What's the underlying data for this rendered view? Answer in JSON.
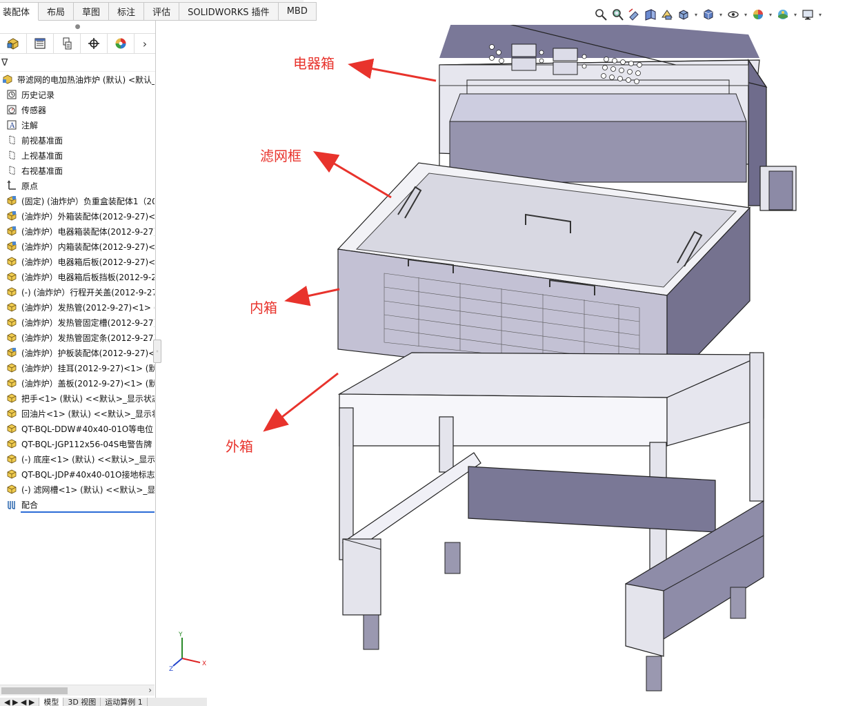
{
  "command_tabs": [
    "装配体",
    "布局",
    "草图",
    "标注",
    "评估",
    "SOLIDWORKS 插件",
    "MBD"
  ],
  "panel_tabs": [
    {
      "icon": "feature-manager-icon"
    },
    {
      "icon": "property-manager-icon"
    },
    {
      "icon": "configuration-manager-icon"
    },
    {
      "icon": "dimxpert-icon"
    },
    {
      "icon": "display-manager-icon"
    }
  ],
  "panel_more_glyph": "›",
  "filter_glyph": "∇",
  "tree": [
    {
      "label": "带滤网的电加热油炸炉 (默认) <默认_显示",
      "icon": "assembly-root-icon"
    },
    {
      "label": "历史记录",
      "icon": "history-icon"
    },
    {
      "label": "传感器",
      "icon": "sensor-icon"
    },
    {
      "label": "注解",
      "icon": "annotation-icon"
    },
    {
      "label": "前视基准面",
      "icon": "plane-icon"
    },
    {
      "label": "上视基准面",
      "icon": "plane-icon"
    },
    {
      "label": "右视基准面",
      "icon": "plane-icon"
    },
    {
      "label": "原点",
      "icon": "origin-icon"
    },
    {
      "label": "(固定) (油炸炉）负重盒装配体1（20",
      "icon": "subassembly-icon"
    },
    {
      "label": "(油炸炉）外箱装配体(2012-9-27)<",
      "icon": "subassembly-icon"
    },
    {
      "label": "(油炸炉）电器箱装配体(2012-9-27)",
      "icon": "subassembly-icon"
    },
    {
      "label": "(油炸炉）内箱装配体(2012-9-27)<",
      "icon": "subassembly-icon"
    },
    {
      "label": "(油炸炉）电器箱后板(2012-9-27)<",
      "icon": "part-icon"
    },
    {
      "label": "(油炸炉）电器箱后板挡板(2012-9-2",
      "icon": "part-icon"
    },
    {
      "label": "(-) (油炸炉）行程开关盖(2012-9-27",
      "icon": "part-icon"
    },
    {
      "label": "(油炸炉）发热管(2012-9-27)<1> (",
      "icon": "part-icon"
    },
    {
      "label": "(油炸炉）发热管固定槽(2012-9-27)",
      "icon": "part-icon"
    },
    {
      "label": "(油炸炉）发热管固定条(2012-9-27)",
      "icon": "part-icon"
    },
    {
      "label": "(油炸炉）护板装配体(2012-9-27)<",
      "icon": "subassembly-icon"
    },
    {
      "label": "(油炸炉）挂耳(2012-9-27)<1> (默",
      "icon": "part-icon"
    },
    {
      "label": "(油炸炉）盖板(2012-9-27)<1> (默",
      "icon": "part-icon"
    },
    {
      "label": "把手<1> (默认) <<默认>_显示状态",
      "icon": "part-icon"
    },
    {
      "label": "回油片<1> (默认) <<默认>_显示状",
      "icon": "part-icon"
    },
    {
      "label": "QT-BQL-DDW#40x40-01O等电位",
      "icon": "part-icon"
    },
    {
      "label": "QT-BQL-JGP112x56-04S电警告牌",
      "icon": "part-icon"
    },
    {
      "label": "(-) 底座<1> (默认) <<默认>_显示",
      "icon": "part-icon"
    },
    {
      "label": "QT-BQL-JDP#40x40-01O接地标志",
      "icon": "part-icon"
    },
    {
      "label": "(-) 滤网槽<1> (默认) <<默认>_显示",
      "icon": "part-icon"
    },
    {
      "label": "配合",
      "icon": "mates-icon"
    }
  ],
  "bottom_tabs": [
    "",
    "模型",
    "3D 视图",
    "运动算例 1"
  ],
  "heads_up_toolbar": [
    "zoom-to-fit-icon",
    "zoom-area-icon",
    "previous-view-icon",
    "section-view-icon",
    "dynamic-annotation-icon",
    "view-orientation-icon",
    "display-style-icon",
    "hide-show-items-icon",
    "edit-appearance-icon",
    "apply-scene-icon",
    "view-settings-icon"
  ],
  "callouts": [
    {
      "id": "electrical-box",
      "text": "电器箱"
    },
    {
      "id": "filter-frame",
      "text": "滤网框"
    },
    {
      "id": "inner-tank",
      "text": "内箱"
    },
    {
      "id": "outer-tank",
      "text": "外箱"
    }
  ],
  "triad": {
    "x": "X",
    "y": "Y",
    "z": "Z"
  },
  "colors": {
    "accent_red": "#e8332c",
    "steel": "#8c8aa6",
    "steel_dark": "#6f6c8c",
    "steel_light": "#e4e4ec",
    "tree_blue": "#2a6bd6"
  }
}
